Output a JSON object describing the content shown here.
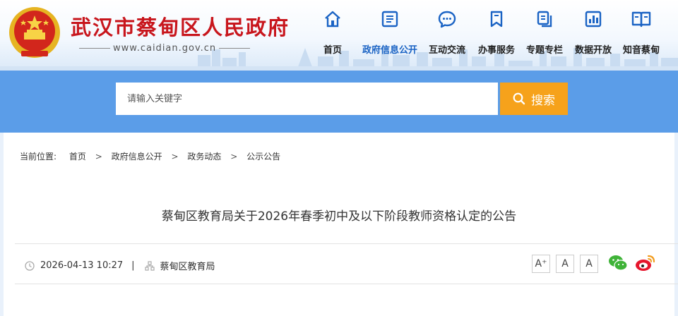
{
  "site": {
    "title": "武汉市蔡甸区人民政府",
    "url": "www.caidian.gov.cn"
  },
  "nav": {
    "items": [
      {
        "label": "首页",
        "icon": "home-icon",
        "active": false
      },
      {
        "label": "政府信息公开",
        "icon": "document-list-icon",
        "active": true
      },
      {
        "label": "互动交流",
        "icon": "chat-bubble-icon",
        "active": false
      },
      {
        "label": "办事服务",
        "icon": "bookmark-icon",
        "active": false
      },
      {
        "label": "专题专栏",
        "icon": "copy-pages-icon",
        "active": false
      },
      {
        "label": "数据开放",
        "icon": "bar-chart-icon",
        "active": false
      },
      {
        "label": "知音蔡甸",
        "icon": "open-book-icon",
        "active": false
      }
    ],
    "active_color": "#1a63c4"
  },
  "search": {
    "placeholder": "请输入关键字",
    "button_label": "搜索",
    "button_color": "#f6a21b"
  },
  "breadcrumb": {
    "label": "当前位置:",
    "items": [
      "首页",
      "政府信息公开",
      "政务动态",
      "公示公告"
    ],
    "separator": ">"
  },
  "article": {
    "title": "蔡甸区教育局关于2026年春季初中及以下阶段教师资格认定的公告",
    "date": "2026-04-13 10:27",
    "source": "蔡甸区教育局"
  },
  "toolbar": {
    "font_buttons": [
      "A⁺",
      "A",
      "A"
    ]
  },
  "colors": {
    "title_red": "#c8161d",
    "search_band": "#5b9de8"
  }
}
